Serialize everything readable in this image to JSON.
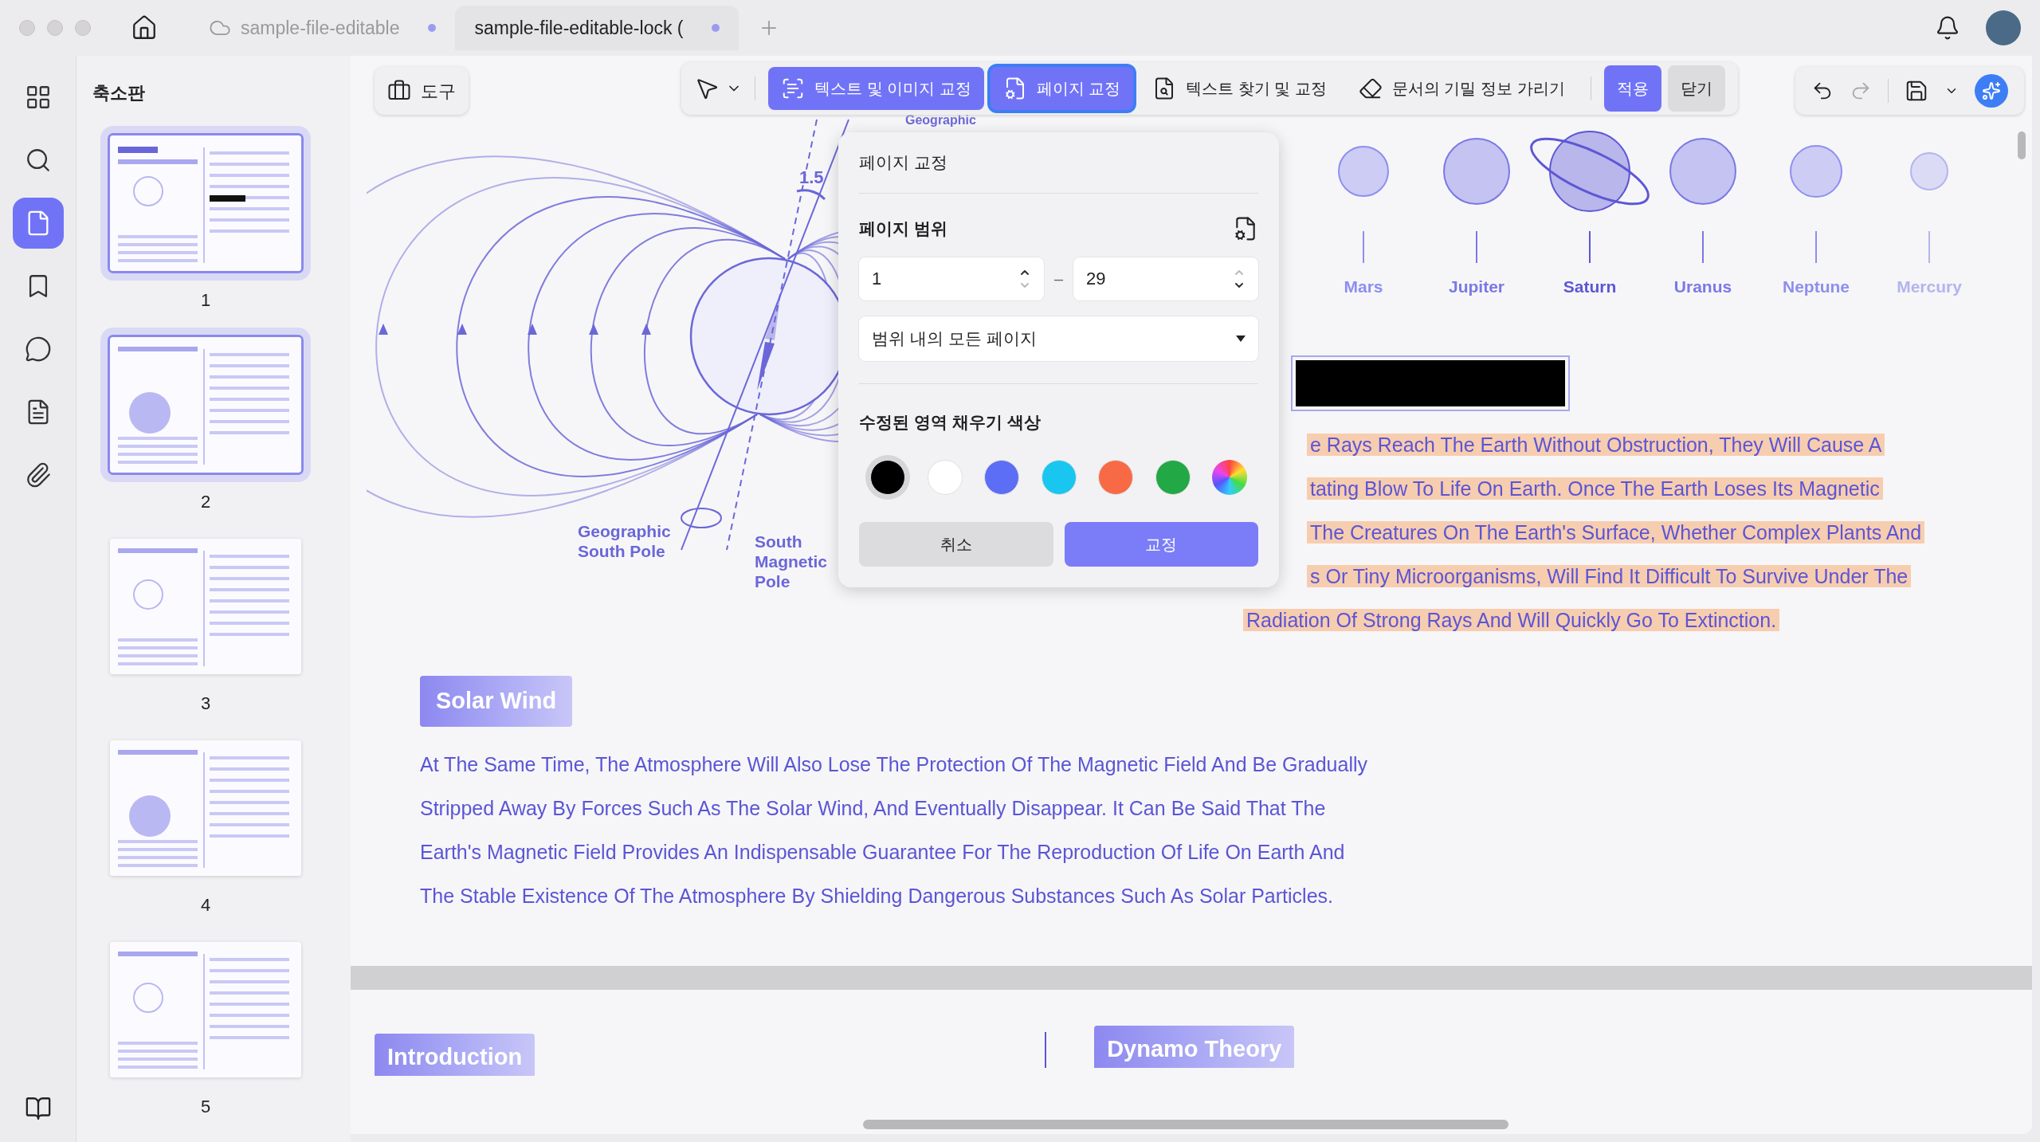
{
  "tabs": [
    {
      "title": "sample-file-editable",
      "selected": false,
      "cloud": true,
      "unsaved": true
    },
    {
      "title": "sample-file-editable-lock (",
      "selected": true,
      "cloud": false,
      "unsaved": true
    }
  ],
  "rail": [
    {
      "kind": "grid",
      "selected": false
    },
    {
      "kind": "search",
      "selected": false
    },
    {
      "kind": "pages",
      "selected": true
    },
    {
      "kind": "bookmark",
      "selected": false
    },
    {
      "kind": "comment",
      "selected": false
    },
    {
      "kind": "file",
      "selected": false
    },
    {
      "kind": "attach",
      "selected": false
    }
  ],
  "panel": {
    "title": "축소판",
    "thumbnails": [
      {
        "label": "1",
        "selected": true
      },
      {
        "label": "2",
        "selected": true
      },
      {
        "label": "3",
        "selected": false
      },
      {
        "label": "4",
        "selected": false
      },
      {
        "label": "5",
        "selected": false
      }
    ]
  },
  "toolbar": {
    "tools": "도구",
    "modes": [
      {
        "kind": "text-image",
        "label": "텍스트 및 이미지 교정",
        "highlighted": true,
        "selected": false
      },
      {
        "kind": "page",
        "label": "페이지 교정",
        "highlighted": true,
        "selected": true
      },
      {
        "kind": "find",
        "label": "텍스트 찾기 및 교정",
        "highlighted": false,
        "selected": false
      },
      {
        "kind": "redact",
        "label": "문서의 기밀 정보 가리기",
        "highlighted": false,
        "selected": false
      }
    ],
    "apply": "적용",
    "close": "닫기"
  },
  "popup": {
    "title": "페이지 교정",
    "range_label": "페이지 범위",
    "from": {
      "value": "1",
      "can_increase": true,
      "can_decrease": false
    },
    "to": {
      "value": "29",
      "can_increase": false,
      "can_decrease": true
    },
    "separator": "–",
    "scope": "범위 내의 모든 페이지",
    "fill_label": "수정된 영역 채우기 색상",
    "swatches": [
      {
        "kind": "solid",
        "color": "#000000",
        "selected": true
      },
      {
        "kind": "solid",
        "color": "#ffffff",
        "selected": false
      },
      {
        "kind": "solid",
        "color": "#5b6ef5",
        "selected": false
      },
      {
        "kind": "solid",
        "color": "#19c6f0",
        "selected": false
      },
      {
        "kind": "solid",
        "color": "#f86a45",
        "selected": false
      },
      {
        "kind": "solid",
        "color": "#22a845",
        "selected": false
      },
      {
        "kind": "spectrum",
        "selected": false
      }
    ],
    "cancel": "취소",
    "confirm": "교정"
  },
  "diagram": {
    "angle": "1.5",
    "top_label": "Geographic",
    "south_pole": [
      "Geographic",
      "South Pole"
    ],
    "magnetic_pole": [
      "South",
      "Magnetic",
      "Pole"
    ]
  },
  "planets": [
    {
      "name": "Mars",
      "color": "#8e8ef0",
      "ringed": false
    },
    {
      "name": "Jupiter",
      "color": "#7b78e6",
      "ringed": false
    },
    {
      "name": "Saturn",
      "color": "#5d57d6",
      "ringed": true
    },
    {
      "name": "Uranus",
      "color": "#7b78e6",
      "ringed": false
    },
    {
      "name": "Neptune",
      "color": "#8e8ef0",
      "ringed": false
    },
    {
      "name": "Mercury",
      "color": "#b4b4f0",
      "ringed": false
    }
  ],
  "highlighted_lines": [
    "e Rays Reach The Earth Without Obstruction, They Will Cause A",
    "tating Blow To Life On Earth. Once The Earth Loses Its Magnetic",
    "The Creatures On The Earth's Surface, Whether Complex Plants And",
    "s Or Tiny Microorganisms, Will Find It Difficult To Survive Under The",
    "Radiation Of Strong Rays And Will Quickly Go To Extinction."
  ],
  "solar_wind": {
    "heading": "Solar Wind",
    "lines": [
      "At The Same Time, The Atmosphere Will Also Lose The Protection Of The Magnetic Field And Be Gradually",
      "Stripped Away By Forces Such As The Solar Wind, And Eventually Disappear. It Can Be Said That The",
      "Earth's Magnetic Field Provides An Indispensable Guarantee For The Reproduction Of Life On Earth And",
      "The Stable Existence Of The Atmosphere By Shielding Dangerous Substances Such As Solar Particles."
    ]
  },
  "next_page": {
    "left_heading": "Introduction",
    "right_heading": "Dynamo Theory"
  }
}
